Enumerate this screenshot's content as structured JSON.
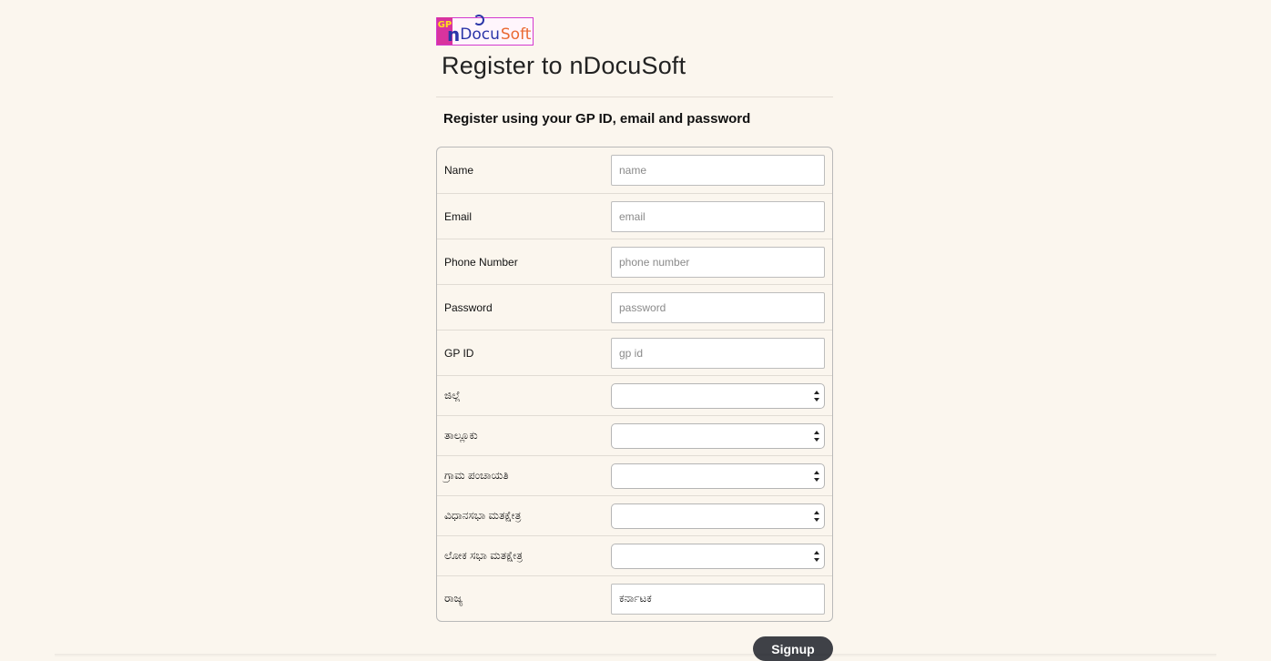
{
  "logo": {
    "gp_text": "GP",
    "n_text": "n",
    "docu_text": "Docu",
    "soft_text": "Soft",
    "colors": {
      "gp_bg": "#d8339e",
      "gp_text": "#ffe11a",
      "docu": "#2a35a8",
      "soft": "#ea6a33"
    }
  },
  "header": {
    "title": "Register to nDocuSoft",
    "subtitle": "Register using your GP ID, email and password"
  },
  "form": {
    "fields": [
      {
        "label": "Name",
        "placeholder": "name",
        "value": ""
      },
      {
        "label": "Email",
        "placeholder": "email",
        "value": ""
      },
      {
        "label": "Phone Number",
        "placeholder": "phone number",
        "value": ""
      },
      {
        "label": "Password",
        "placeholder": "password",
        "value": ""
      },
      {
        "label": "GP ID",
        "placeholder": "gp id",
        "value": ""
      },
      {
        "label": "ಜಿಲ್ಲೆ",
        "value": ""
      },
      {
        "label": "ತಾಲ್ಲೂಕು",
        "value": ""
      },
      {
        "label": "ಗ್ರಾಮ ಪಂಚಾಯತಿ",
        "value": ""
      },
      {
        "label": "ವಿಧಾನಸಭಾ ಮತಕ್ಷೇತ್ರ",
        "value": ""
      },
      {
        "label": "ಲೋಕ ಸಭಾ ಮತಕ್ಷೇತ್ರ",
        "value": ""
      },
      {
        "label": "ರಾಜ್ಯ",
        "value": "ಕರ್ನಾಟಕ"
      }
    ]
  },
  "actions": {
    "signup_label": "Signup"
  },
  "colors": {
    "page_bg": "#fbf6ee",
    "button_bg": "#3f4147"
  }
}
